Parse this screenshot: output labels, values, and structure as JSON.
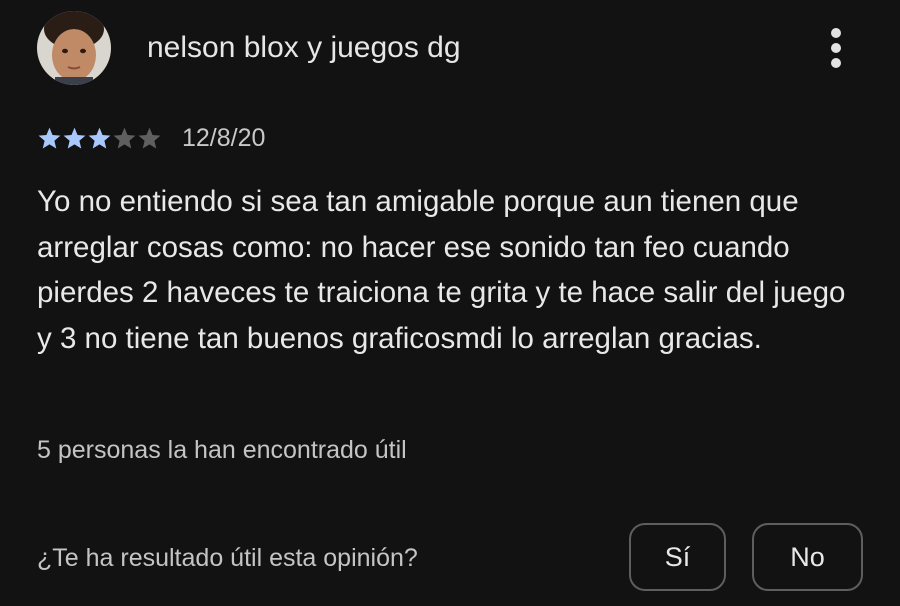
{
  "review": {
    "author": "nelson blox y juegos dg",
    "avatar_icon": "child-face-avatar",
    "menu_icon": "more-vert-icon",
    "rating": 3,
    "rating_max": 5,
    "date": "12/8/20",
    "text": "Yo no entiendo si sea tan amigable porque aun tienen que arreglar cosas como: no hacer ese sonido tan feo cuando pierdes 2 haveces te traiciona te grita y te hace salir del juego y 3 no tiene tan buenos graficosmdi lo arreglan gracias.",
    "helpful_count": "5 personas la han encontrado útil"
  },
  "feedback": {
    "question": "¿Te ha resultado útil esta opinión?",
    "yes_label": "Sí",
    "no_label": "No"
  },
  "colors": {
    "background": "#121212",
    "star_filled": "#a8c7fa",
    "star_empty": "#5f5f5f",
    "button_border": "#5e5e5e"
  }
}
